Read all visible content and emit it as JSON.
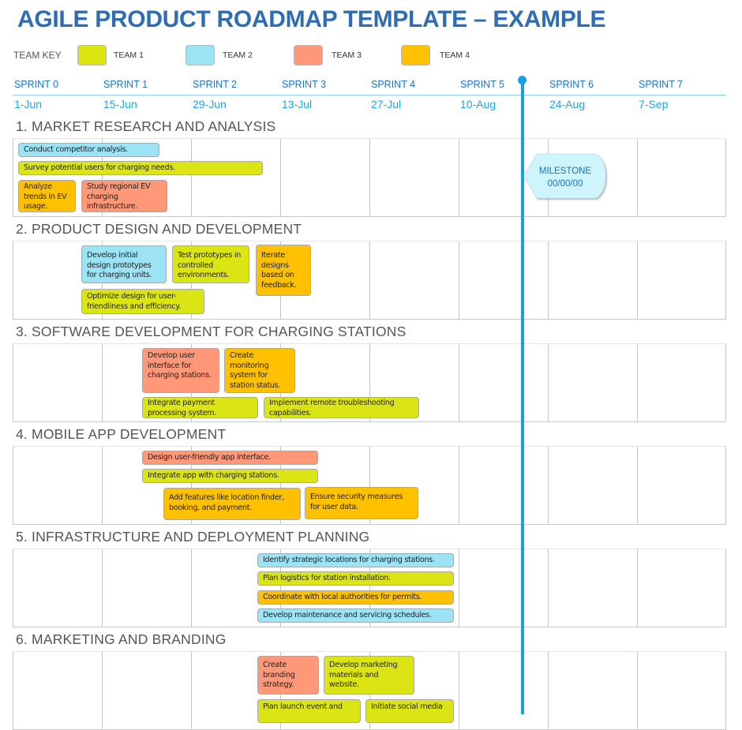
{
  "title": "AGILE PRODUCT ROADMAP TEMPLATE – EXAMPLE",
  "team_key": {
    "label": "TEAM KEY",
    "teams": [
      {
        "name": "TEAM 1",
        "color": "#DCE514"
      },
      {
        "name": "TEAM 2",
        "color": "#9BE3F5"
      },
      {
        "name": "TEAM 3",
        "color": "#FF9878"
      },
      {
        "name": "TEAM 4",
        "color": "#FFC000"
      }
    ]
  },
  "sprints": [
    {
      "name": "SPRINT 0",
      "date": "1-Jun"
    },
    {
      "name": "SPRINT 1",
      "date": "15-Jun"
    },
    {
      "name": "SPRINT 2",
      "date": "29-Jun"
    },
    {
      "name": "SPRINT 3",
      "date": "13-Jul"
    },
    {
      "name": "SPRINT 4",
      "date": "27-Jul"
    },
    {
      "name": "SPRINT 5",
      "date": "10-Aug"
    },
    {
      "name": "SPRINT 6",
      "date": "24-Aug"
    },
    {
      "name": "SPRINT 7",
      "date": "7-Sep"
    }
  ],
  "milestone": {
    "label": "MILESTONE",
    "date": "00/00/00",
    "color": "#1a9fe0"
  },
  "sections": [
    {
      "title": "1. MARKET RESEARCH AND ANALYSIS",
      "tasks": [
        {
          "text": "Conduct competitor analysis.",
          "team": "TEAM 2"
        },
        {
          "text": "Survey potential users for charging needs.",
          "team": "TEAM 1"
        },
        {
          "text": "Analyze trends in EV usage.",
          "team": "TEAM 4"
        },
        {
          "text": "Study regional EV charging infrastructure.",
          "team": "TEAM 3"
        }
      ]
    },
    {
      "title": "2. PRODUCT DESIGN AND DEVELOPMENT",
      "tasks": [
        {
          "text": "Develop initial design prototypes for charging units.",
          "team": "TEAM 2"
        },
        {
          "text": "Test prototypes in controlled environments.",
          "team": "TEAM 1"
        },
        {
          "text": "Iterate designs based on feedback.",
          "team": "TEAM 4"
        },
        {
          "text": "Optimize design for user-friendliness and efficiency.",
          "team": "TEAM 1"
        }
      ]
    },
    {
      "title": "3. SOFTWARE DEVELOPMENT FOR CHARGING STATIONS",
      "tasks": [
        {
          "text": "Develop user interface for charging stations.",
          "team": "TEAM 3"
        },
        {
          "text": "Create monitoring system for station status.",
          "team": "TEAM 4"
        },
        {
          "text": "Integrate payment processing system.",
          "team": "TEAM 1"
        },
        {
          "text": "Implement remote troubleshooting capabilities.",
          "team": "TEAM 1"
        }
      ]
    },
    {
      "title": "4. MOBILE APP DEVELOPMENT",
      "tasks": [
        {
          "text": "Design user-friendly app interface.",
          "team": "TEAM 3"
        },
        {
          "text": "Integrate app with charging stations.",
          "team": "TEAM 1"
        },
        {
          "text": "Add features like location finder, booking, and payment.",
          "team": "TEAM 4"
        },
        {
          "text": "Ensure security measures for user data.",
          "team": "TEAM 4"
        }
      ]
    },
    {
      "title": "5. INFRASTRUCTURE AND DEPLOYMENT PLANNING",
      "tasks": [
        {
          "text": "Identify strategic locations for charging stations.",
          "team": "TEAM 2"
        },
        {
          "text": "Plan logistics for station installation.",
          "team": "TEAM 1"
        },
        {
          "text": "Coordinate with local authorities for permits.",
          "team": "TEAM 4"
        },
        {
          "text": "Develop maintenance and servicing schedules.",
          "team": "TEAM 2"
        }
      ]
    },
    {
      "title": "6. MARKETING AND BRANDING",
      "tasks": [
        {
          "text": "Create branding strategy.",
          "team": "TEAM 3"
        },
        {
          "text": "Develop marketing materials and website.",
          "team": "TEAM 1"
        },
        {
          "text": "Plan launch event and",
          "team": "TEAM 1"
        },
        {
          "text": "Initiate social media",
          "team": "TEAM 1"
        }
      ]
    }
  ]
}
